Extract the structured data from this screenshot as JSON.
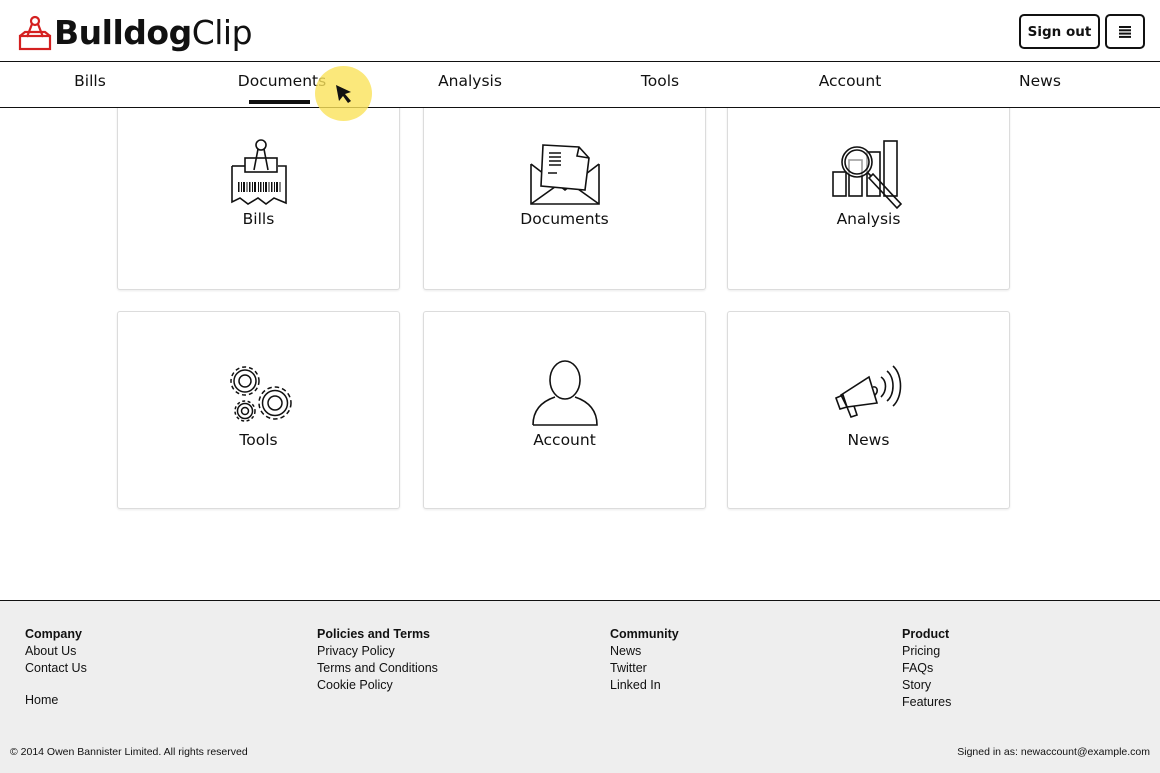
{
  "header": {
    "brand_bold": "Bulldog",
    "brand_light": "Clip",
    "brand_color": "#d42020",
    "signout_label": "Sign out",
    "menu_icon": "hamburger-icon"
  },
  "nav": {
    "active": "Documents",
    "items": [
      {
        "label": "Bills"
      },
      {
        "label": "Documents"
      },
      {
        "label": "Analysis"
      },
      {
        "label": "Tools"
      },
      {
        "label": "Account"
      },
      {
        "label": "News"
      }
    ]
  },
  "cards": [
    {
      "label": "Bills",
      "icon": "receipt-clip-icon"
    },
    {
      "label": "Documents",
      "icon": "envelope-document-icon"
    },
    {
      "label": "Analysis",
      "icon": "bar-chart-magnifier-icon"
    },
    {
      "label": "Tools",
      "icon": "gears-icon"
    },
    {
      "label": "Account",
      "icon": "user-silhouette-icon"
    },
    {
      "label": "News",
      "icon": "megaphone-icon"
    }
  ],
  "footer": {
    "columns": [
      {
        "heading": "Company",
        "links": [
          "About Us",
          "Contact Us"
        ],
        "extra": "Home"
      },
      {
        "heading": "Policies and Terms",
        "links": [
          "Privacy Policy",
          "Terms and Conditions",
          "Cookie Policy"
        ]
      },
      {
        "heading": "Community",
        "links": [
          "News",
          "Twitter",
          "Linked In"
        ]
      },
      {
        "heading": "Product",
        "links": [
          "Pricing",
          "FAQs",
          "Story",
          "Features"
        ]
      }
    ],
    "copyright": "© 2014 Owen Bannister Limited. All rights reserved",
    "signed_in": "Signed in as: newaccount@example.com"
  }
}
